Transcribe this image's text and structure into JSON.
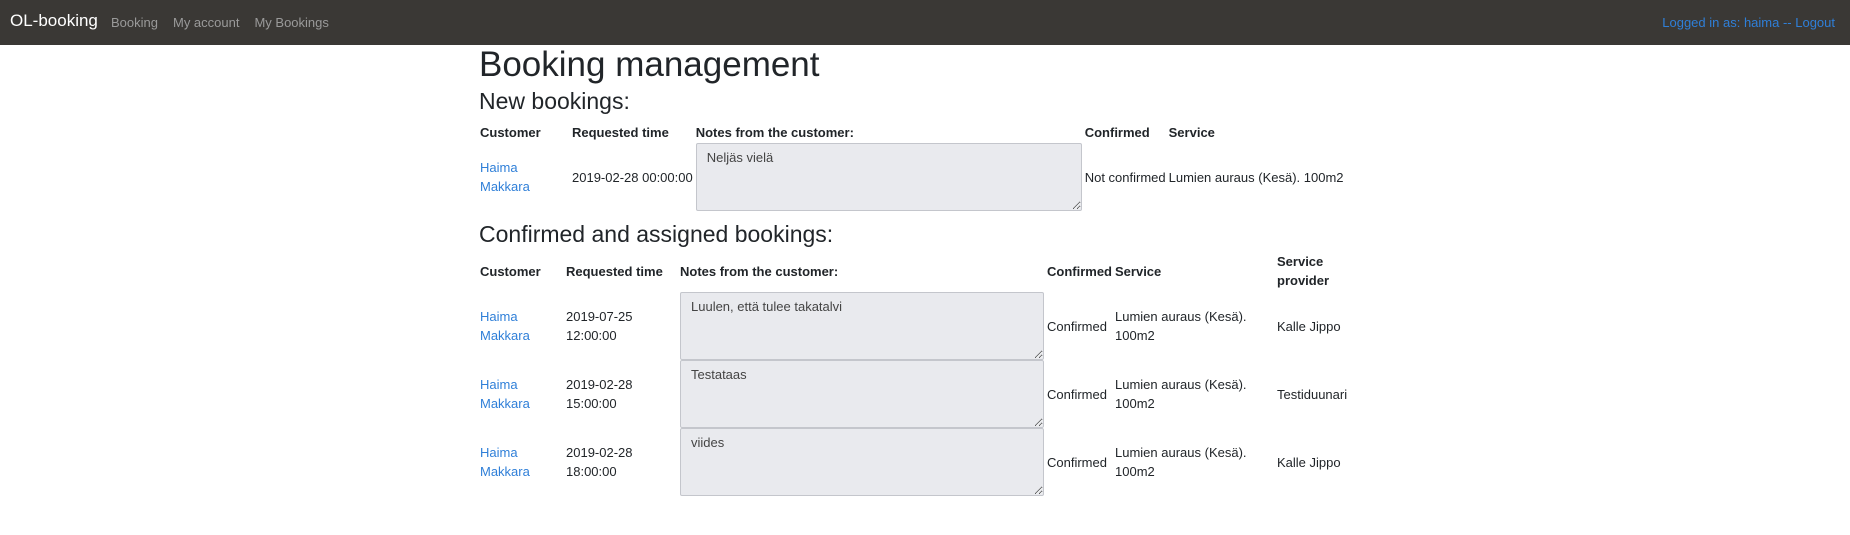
{
  "navbar": {
    "brand": "OL-booking",
    "links": [
      {
        "label": "Booking"
      },
      {
        "label": "My account"
      },
      {
        "label": "My Bookings"
      }
    ],
    "login_text": "Logged in as: haima -- Logout"
  },
  "page_title": "Booking management",
  "new_bookings": {
    "heading": "New bookings:",
    "columns": [
      "Customer",
      "Requested time",
      "Notes from the customer:",
      "Confirmed",
      "Service"
    ],
    "rows": [
      {
        "customer": "Haima Makkara",
        "time": "2019-02-28 00:00:00",
        "notes": "Neljäs vielä",
        "confirmed": "Not confirmed",
        "service": "Lumien auraus (Kesä). 100m2"
      }
    ]
  },
  "confirmed_bookings": {
    "heading": "Confirmed and assigned bookings:",
    "columns": [
      "Customer",
      "Requested time",
      "Notes from the customer:",
      "Confirmed",
      "Service",
      "Service provider"
    ],
    "rows": [
      {
        "customer": "Haima Makkara",
        "time": "2019-07-25 12:00:00",
        "notes": "Luulen, että tulee takatalvi",
        "confirmed": "Confirmed",
        "service": "Lumien auraus (Kesä). 100m2",
        "provider": "Kalle Jippo"
      },
      {
        "customer": "Haima Makkara",
        "time": "2019-02-28 15:00:00",
        "notes": "Testataas",
        "confirmed": "Confirmed",
        "service": "Lumien auraus (Kesä). 100m2",
        "provider": "Testiduunari"
      },
      {
        "customer": "Haima Makkara",
        "time": "2019-02-28 18:00:00",
        "notes": "viides",
        "confirmed": "Confirmed",
        "service": "Lumien auraus (Kesä). 100m2",
        "provider": "Kalle Jippo"
      }
    ]
  }
}
